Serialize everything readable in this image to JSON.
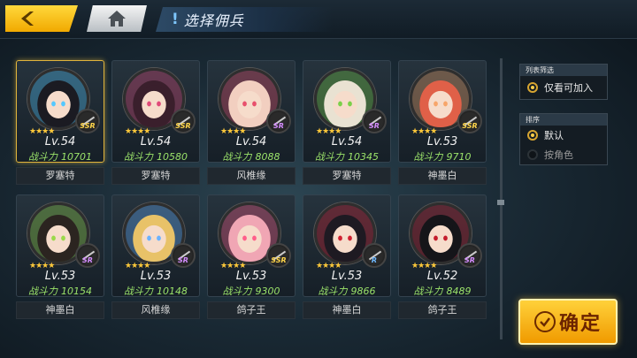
{
  "header": {
    "title": "选择佣兵",
    "back_icon": "chevron-left-icon",
    "home_icon": "home-icon"
  },
  "mercenaries": [
    {
      "level": "Lv.54",
      "power_label": "战斗力",
      "power": "10701",
      "name": "罗塞特",
      "rarity": "SSR",
      "selected": true,
      "hair": "#1b1b22",
      "accent": "#55c8ff"
    },
    {
      "level": "Lv.54",
      "power_label": "战斗力",
      "power": "10580",
      "name": "罗塞特",
      "rarity": "SSR",
      "selected": false,
      "hair": "#3a1f2c",
      "accent": "#e04a7a"
    },
    {
      "level": "Lv.54",
      "power_label": "战斗力",
      "power": "8088",
      "name": "风椎缘",
      "rarity": "SR",
      "selected": false,
      "hair": "#f2cfc0",
      "accent": "#e8506d"
    },
    {
      "level": "Lv.54",
      "power_label": "战斗力",
      "power": "10345",
      "name": "罗塞特",
      "rarity": "SR",
      "selected": false,
      "hair": "#e9e2d2",
      "accent": "#7ad04a"
    },
    {
      "level": "Lv.53",
      "power_label": "战斗力",
      "power": "9710",
      "name": "神墨白",
      "rarity": "SSR",
      "selected": false,
      "hair": "#e06048",
      "accent": "#f7a56a"
    },
    {
      "level": "Lv.53",
      "power_label": "战斗力",
      "power": "10154",
      "name": "神墨白",
      "rarity": "SR",
      "selected": false,
      "hair": "#2b2420",
      "accent": "#9ad94a"
    },
    {
      "level": "Lv.53",
      "power_label": "战斗力",
      "power": "10148",
      "name": "风椎缘",
      "rarity": "SR",
      "selected": false,
      "hair": "#e8c268",
      "accent": "#6bb2ff"
    },
    {
      "level": "Lv.53",
      "power_label": "战斗力",
      "power": "9300",
      "name": "鸽子王",
      "rarity": "SSR",
      "selected": false,
      "hair": "#f0a6b4",
      "accent": "#ff5f8a"
    },
    {
      "level": "Lv.53",
      "power_label": "战斗力",
      "power": "9866",
      "name": "神墨白",
      "rarity": "R",
      "selected": false,
      "hair": "#1e1a22",
      "accent": "#d02030"
    },
    {
      "level": "Lv.52",
      "power_label": "战斗力",
      "power": "8489",
      "name": "鸽子王",
      "rarity": "SR",
      "selected": false,
      "hair": "#151519",
      "accent": "#c41c2c"
    }
  ],
  "filter": {
    "header": "列表筛选",
    "option": "仅看可加入"
  },
  "sort": {
    "header": "排序",
    "options": [
      "默认",
      "按角色"
    ]
  },
  "confirm_label": "确定",
  "colors": {
    "accent_gold": "#f1a900",
    "power_green": "#9be36a"
  }
}
